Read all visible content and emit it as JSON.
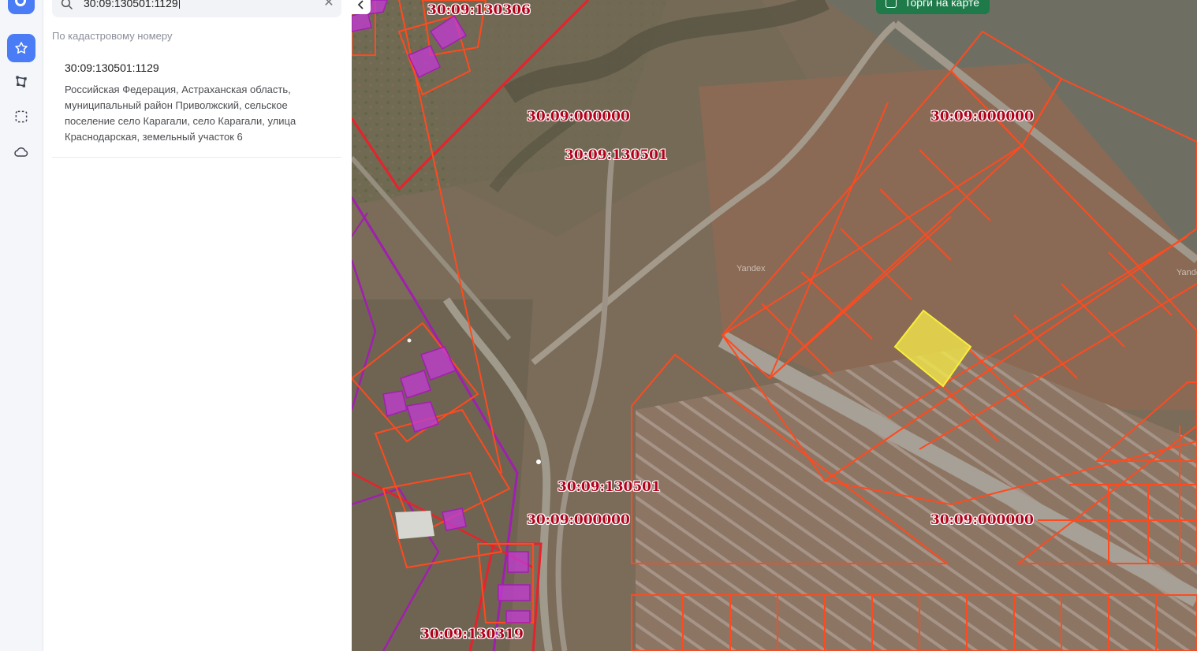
{
  "search": {
    "query": "30:09:130501:1129",
    "clear_icon": "close-icon",
    "search_icon": "search-icon"
  },
  "results": {
    "section_label": "По кадастровому номеру",
    "items": [
      {
        "title": "30:09:130501:1129",
        "address": "Российская Федерация, Астраханская область, муниципальный район Приволжский, сельское поселение село Карагали, село Карагали, улица Краснодарская, земельный участок 6"
      }
    ]
  },
  "rail": {
    "icons": [
      "logo-icon",
      "star-icon",
      "polygon-edit-icon",
      "selection-icon",
      "cloud-icon"
    ],
    "active_color": "#4a7cf5"
  },
  "map": {
    "auction_button": "Торги на карте",
    "watermark": "Yandex",
    "parcel_color": "#ff4a1f",
    "building_color": "#c43ad6",
    "highlight_color": "#f2e64a",
    "labels": {
      "l1": "30:09:130306",
      "l2": "30:09:000000",
      "l3": "30:09:000000",
      "l4": "30:09:130501",
      "l5": "30:09:130501",
      "l6": "30:09:000000",
      "l7": "30:09:000000",
      "l8": "30:09:130319"
    }
  }
}
